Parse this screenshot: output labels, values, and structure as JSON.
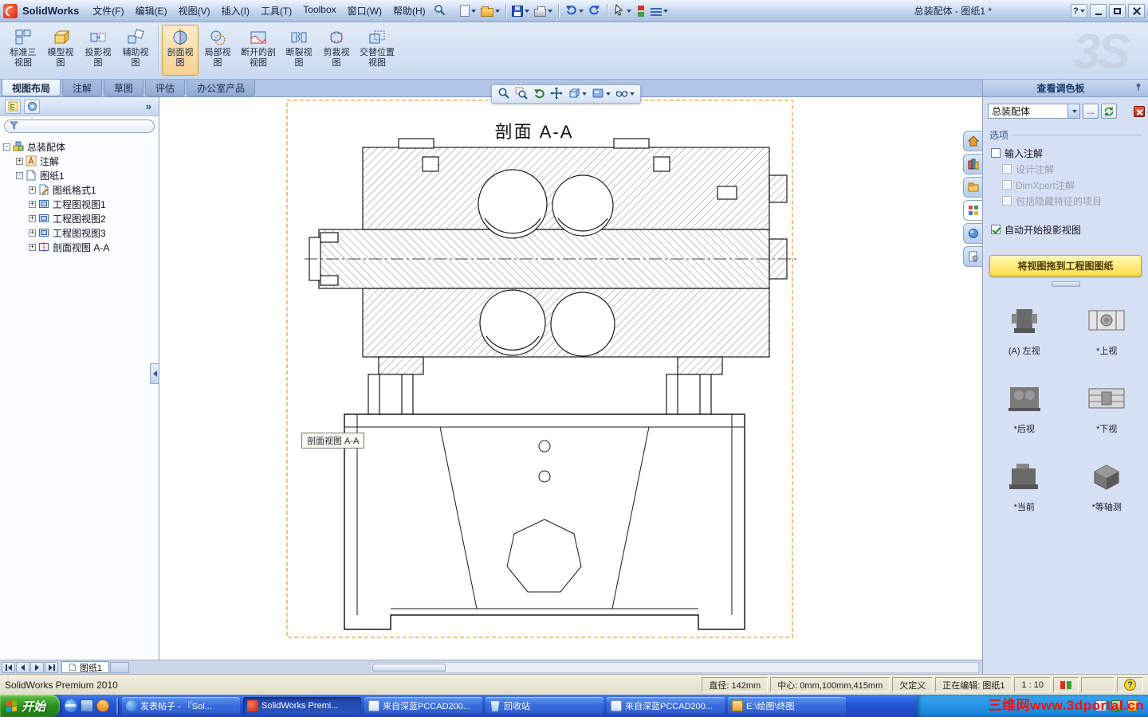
{
  "titlebar": {
    "app_name": "SolidWorks",
    "menus": [
      "文件(F)",
      "编辑(E)",
      "视图(V)",
      "插入(I)",
      "工具(T)",
      "Toolbox",
      "窗口(W)",
      "帮助(H)"
    ],
    "doc_title": "总装配体 - 图纸1 *",
    "help": "?"
  },
  "ribbon": {
    "buttons": [
      "标准三视图",
      "模型视图",
      "投影视图",
      "辅助视图",
      "剖面视图",
      "局部视图",
      "断开的剖视图",
      "断裂视图",
      "剪裁视图",
      "交替位置视图"
    ],
    "active_button": "剖面视图",
    "watermark": "3S"
  },
  "command_tabs": {
    "items": [
      "视图布局",
      "注解",
      "草图",
      "评估",
      "办公室产品"
    ],
    "active": "视图布局"
  },
  "feature_tree": {
    "expand_button": "»",
    "items": [
      {
        "label": "总装配体",
        "expander": "-"
      },
      {
        "label": "注解",
        "expander": "+"
      },
      {
        "label": "图纸1",
        "expander": "-"
      },
      {
        "label": "图纸格式1",
        "expander": "+"
      },
      {
        "label": "工程图视图1",
        "expander": "+"
      },
      {
        "label": "工程图视图2",
        "expander": "+"
      },
      {
        "label": "工程图视图3",
        "expander": "+"
      },
      {
        "label": "剖面视图 A-A",
        "expander": "+"
      }
    ]
  },
  "canvas": {
    "section_title": "剖面 A-A",
    "view_tooltip": "剖面视图 A-A"
  },
  "task_pane": {
    "title": "查看调色板",
    "model_selector": "总装配体",
    "browse_button": "...",
    "options_label": "选项",
    "checkboxes": [
      {
        "label": "输入注解",
        "checked": false,
        "enabled": true
      },
      {
        "label": "设计注解",
        "checked": false,
        "enabled": false
      },
      {
        "label": "DimXpert注解",
        "checked": false,
        "enabled": false
      },
      {
        "label": "包括隐藏特征的项目",
        "checked": false,
        "enabled": false
      },
      {
        "label": "自动开始投影视图",
        "checked": true,
        "enabled": true
      }
    ],
    "drag_hint": "将视图拖到工程图图纸",
    "thumbnails": [
      "(A) 左视",
      "*上视",
      "*后视",
      "*下视",
      "*当前",
      "*等轴测"
    ]
  },
  "sheet_bar": {
    "active_sheet": "图纸1"
  },
  "statusbar": {
    "app_version": "SolidWorks Premium 2010",
    "diameter": "直径: 142mm",
    "center": "中心: 0mm,100mm,415mm",
    "definition_state": "欠定义",
    "editing": "正在编辑: 图纸1",
    "scale": "1 : 10",
    "help": "?"
  },
  "taskbar": {
    "start_label": "开始",
    "tasks": [
      "发表帖子 - 『Sol...",
      "SolidWorks Premi...",
      "来自深蓝PCCAD200...",
      "回收站",
      "来自深蓝PCCAD200...",
      "E:\\绘图\\终图"
    ],
    "active_task_index": 1,
    "watermark": "三维网www.3dportal.cn"
  }
}
